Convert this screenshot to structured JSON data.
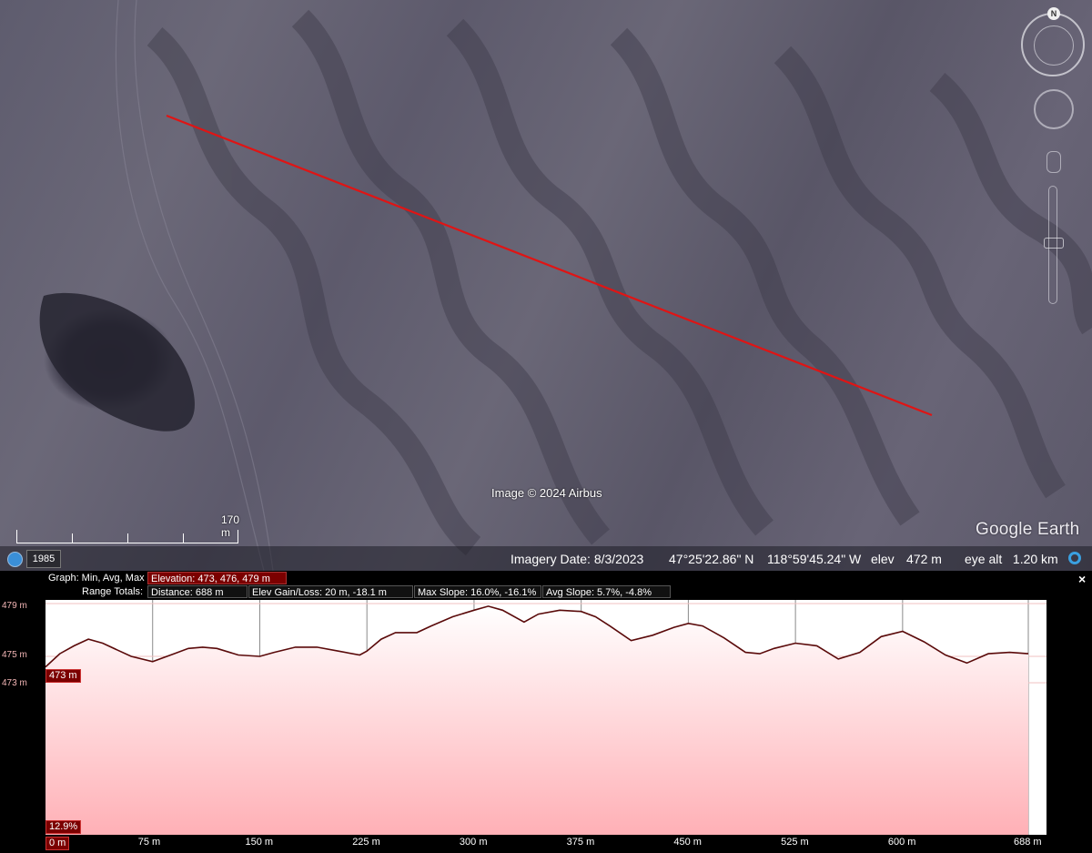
{
  "map": {
    "attribution": "Image © 2024 Airbus",
    "logo": "Google Earth",
    "scale_label": "170 m",
    "compass_north": "N",
    "line_color": "#e01414"
  },
  "status": {
    "year": "1985",
    "imagery_date": "Imagery Date: 8/3/2023",
    "lat": "47°25'22.86\" N",
    "lon": "118°59'45.24\" W",
    "elev_label": "elev",
    "elev_value": "472 m",
    "eye_alt": "eye alt   1.20 km"
  },
  "profile": {
    "graph_label": "Graph: Min, Avg, Max",
    "elevation": "Elevation: 473, 476, 479 m",
    "range_totals_label": "Range Totals:",
    "distance": "Distance: 688 m",
    "gain_loss": "Elev Gain/Loss: 20 m, -18.1 m",
    "max_slope": "Max Slope: 16.0%, -16.1%",
    "avg_slope": "Avg Slope: 5.7%, -4.8%",
    "close": "×",
    "cursor_elev": "473 m",
    "cursor_slope": "12.9%",
    "cursor_dist": "0 m"
  },
  "chart_data": {
    "type": "area",
    "xlabel": "",
    "ylabel": "",
    "x_ticks": [
      "75 m",
      "150 m",
      "225 m",
      "300 m",
      "375 m",
      "450 m",
      "525 m",
      "600 m",
      "688 m"
    ],
    "y_ticks": [
      "479 m",
      "475 m",
      "473 m"
    ],
    "xlim": [
      0,
      688
    ],
    "ylim": [
      473,
      479
    ],
    "series": [
      {
        "x": [
          0,
          10,
          20,
          30,
          40,
          50,
          60,
          75,
          90,
          100,
          110,
          120,
          135,
          150,
          160,
          175,
          190,
          205,
          220,
          225,
          235,
          245,
          260,
          270,
          285,
          300,
          310,
          320,
          335,
          345,
          360,
          375,
          385,
          395,
          410,
          425,
          440,
          450,
          460,
          475,
          490,
          500,
          510,
          525,
          540,
          555,
          570,
          585,
          600,
          615,
          630,
          645,
          660,
          675,
          688
        ],
        "y": [
          474.2,
          475.2,
          475.8,
          476.3,
          476.0,
          475.5,
          475.0,
          474.6,
          475.2,
          475.6,
          475.7,
          475.6,
          475.1,
          475.0,
          475.3,
          475.7,
          475.7,
          475.4,
          475.1,
          475.4,
          476.3,
          476.8,
          476.8,
          477.3,
          478.0,
          478.5,
          478.8,
          478.5,
          477.6,
          478.2,
          478.5,
          478.4,
          478.0,
          477.3,
          476.2,
          476.6,
          477.2,
          477.5,
          477.3,
          476.4,
          475.3,
          475.2,
          475.6,
          476.0,
          475.8,
          474.8,
          475.3,
          476.5,
          476.9,
          476.1,
          475.1,
          474.5,
          475.2,
          475.3,
          475.2
        ]
      }
    ]
  }
}
